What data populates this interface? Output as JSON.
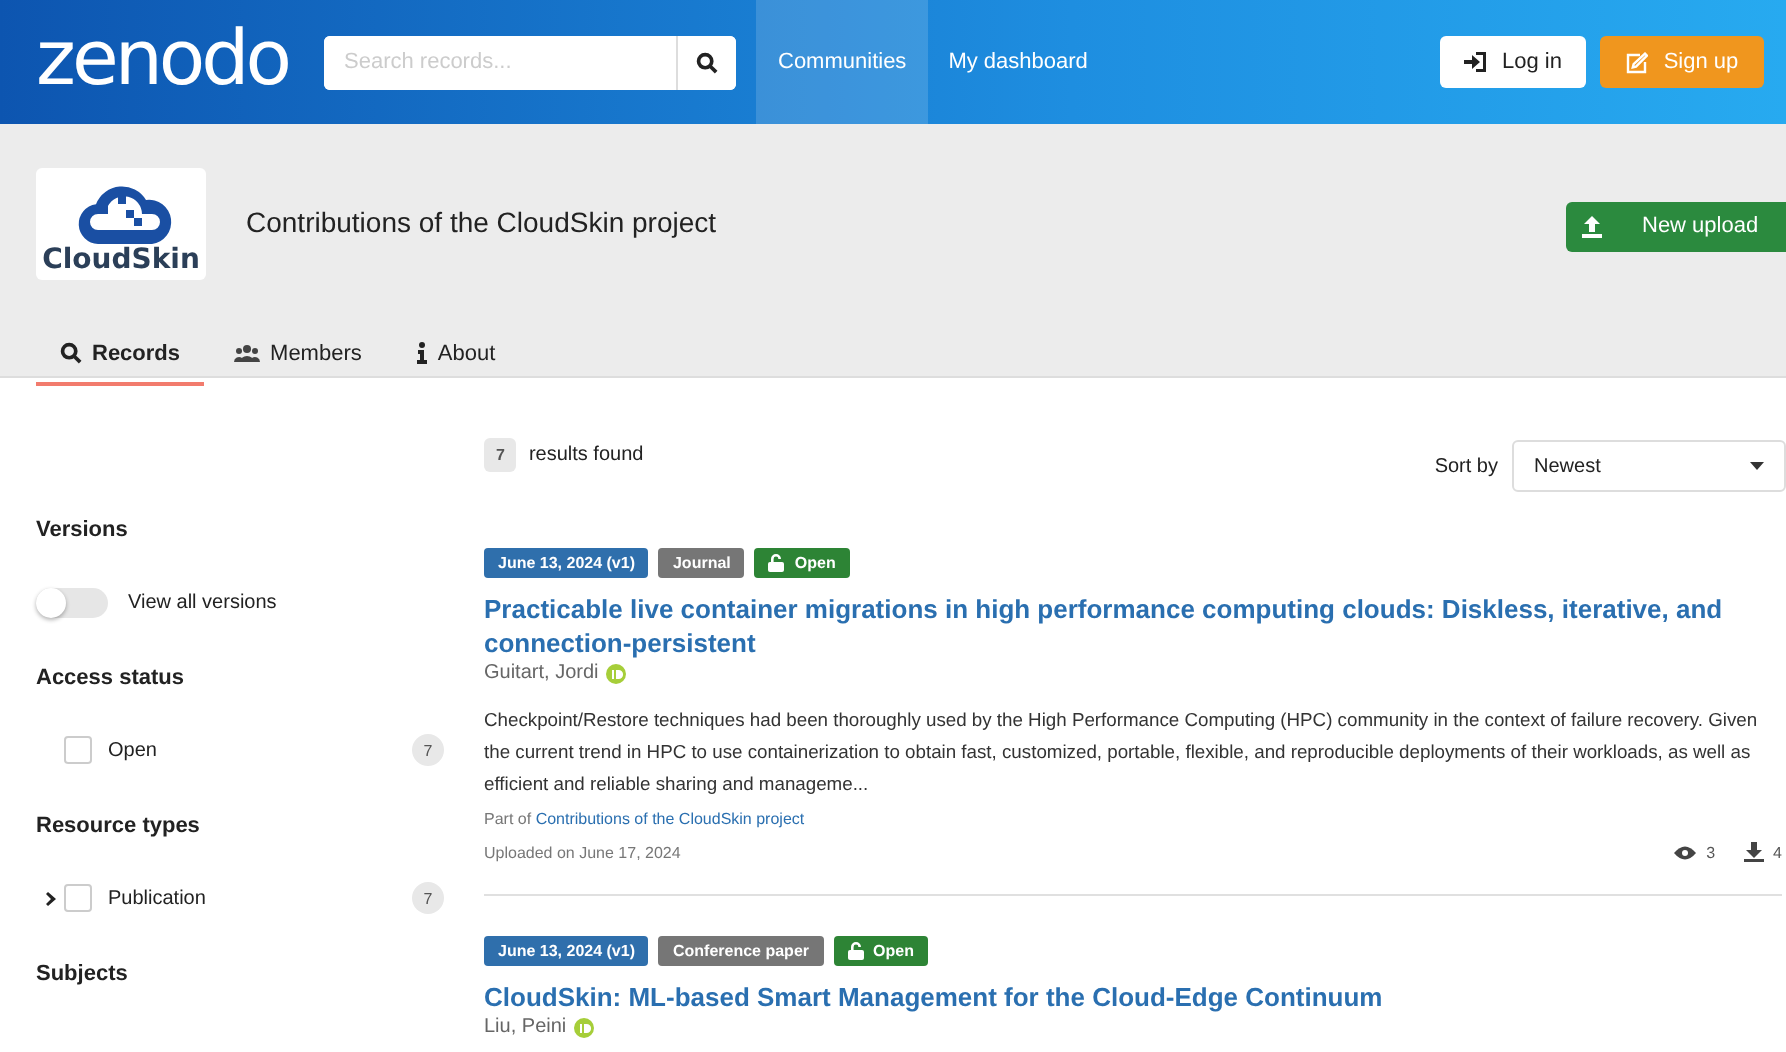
{
  "header": {
    "logo": "zenodo",
    "search": {
      "placeholder": "Search records..."
    },
    "nav": [
      {
        "label": "Communities",
        "selected": true
      },
      {
        "label": "My dashboard",
        "selected": false
      }
    ],
    "login": "Log in",
    "signup": "Sign up"
  },
  "community": {
    "logo_text": "CloudSkin",
    "title": "Contributions of the CloudSkin project",
    "new_upload": "New upload"
  },
  "tabs": [
    {
      "label": "Records",
      "selected": true
    },
    {
      "label": "Members",
      "selected": false
    },
    {
      "label": "About",
      "selected": false
    }
  ],
  "sidebar": {
    "sections": [
      {
        "title": "Versions",
        "items": [
          {
            "kind": "toggle",
            "label": "View all versions",
            "on": false
          }
        ]
      },
      {
        "title": "Access status",
        "items": [
          {
            "kind": "checkbox",
            "label": "Open",
            "count": "7",
            "checked": false
          }
        ]
      },
      {
        "title": "Resource types",
        "items": [
          {
            "kind": "checkbox",
            "label": "Publication",
            "count": "7",
            "checked": false,
            "expanded": false
          }
        ]
      },
      {
        "title": "Subjects"
      }
    ]
  },
  "results": {
    "count": "7",
    "label": "results found",
    "sort_label": "Sort by",
    "sort_value": "Newest"
  },
  "records": [
    {
      "date": "June 13, 2024 (v1)",
      "type": "Journal",
      "access": "Open",
      "title": "Practicable live container migrations in high performance computing clouds: Diskless, iterative, and connection-persistent",
      "author": "Guitart, Jordi",
      "description": "Checkpoint/Restore techniques had been thoroughly used by the High Performance Computing (HPC) community in the context of failure recovery. Given the current trend in HPC to use containerization to obtain fast, customized, portable, flexible, and reproducible deployments of their workloads, as well as efficient and reliable sharing and manageme...",
      "part_of_prefix": "Part of",
      "part_of": "Contributions of the CloudSkin project",
      "uploaded": "Uploaded on June 17, 2024",
      "views": "3",
      "downloads": "4"
    },
    {
      "date": "June 13, 2024 (v1)",
      "type": "Conference paper",
      "access": "Open",
      "title": "CloudSkin: ML-based Smart Management for the Cloud-Edge Continuum",
      "author": "Liu, Peini"
    }
  ]
}
